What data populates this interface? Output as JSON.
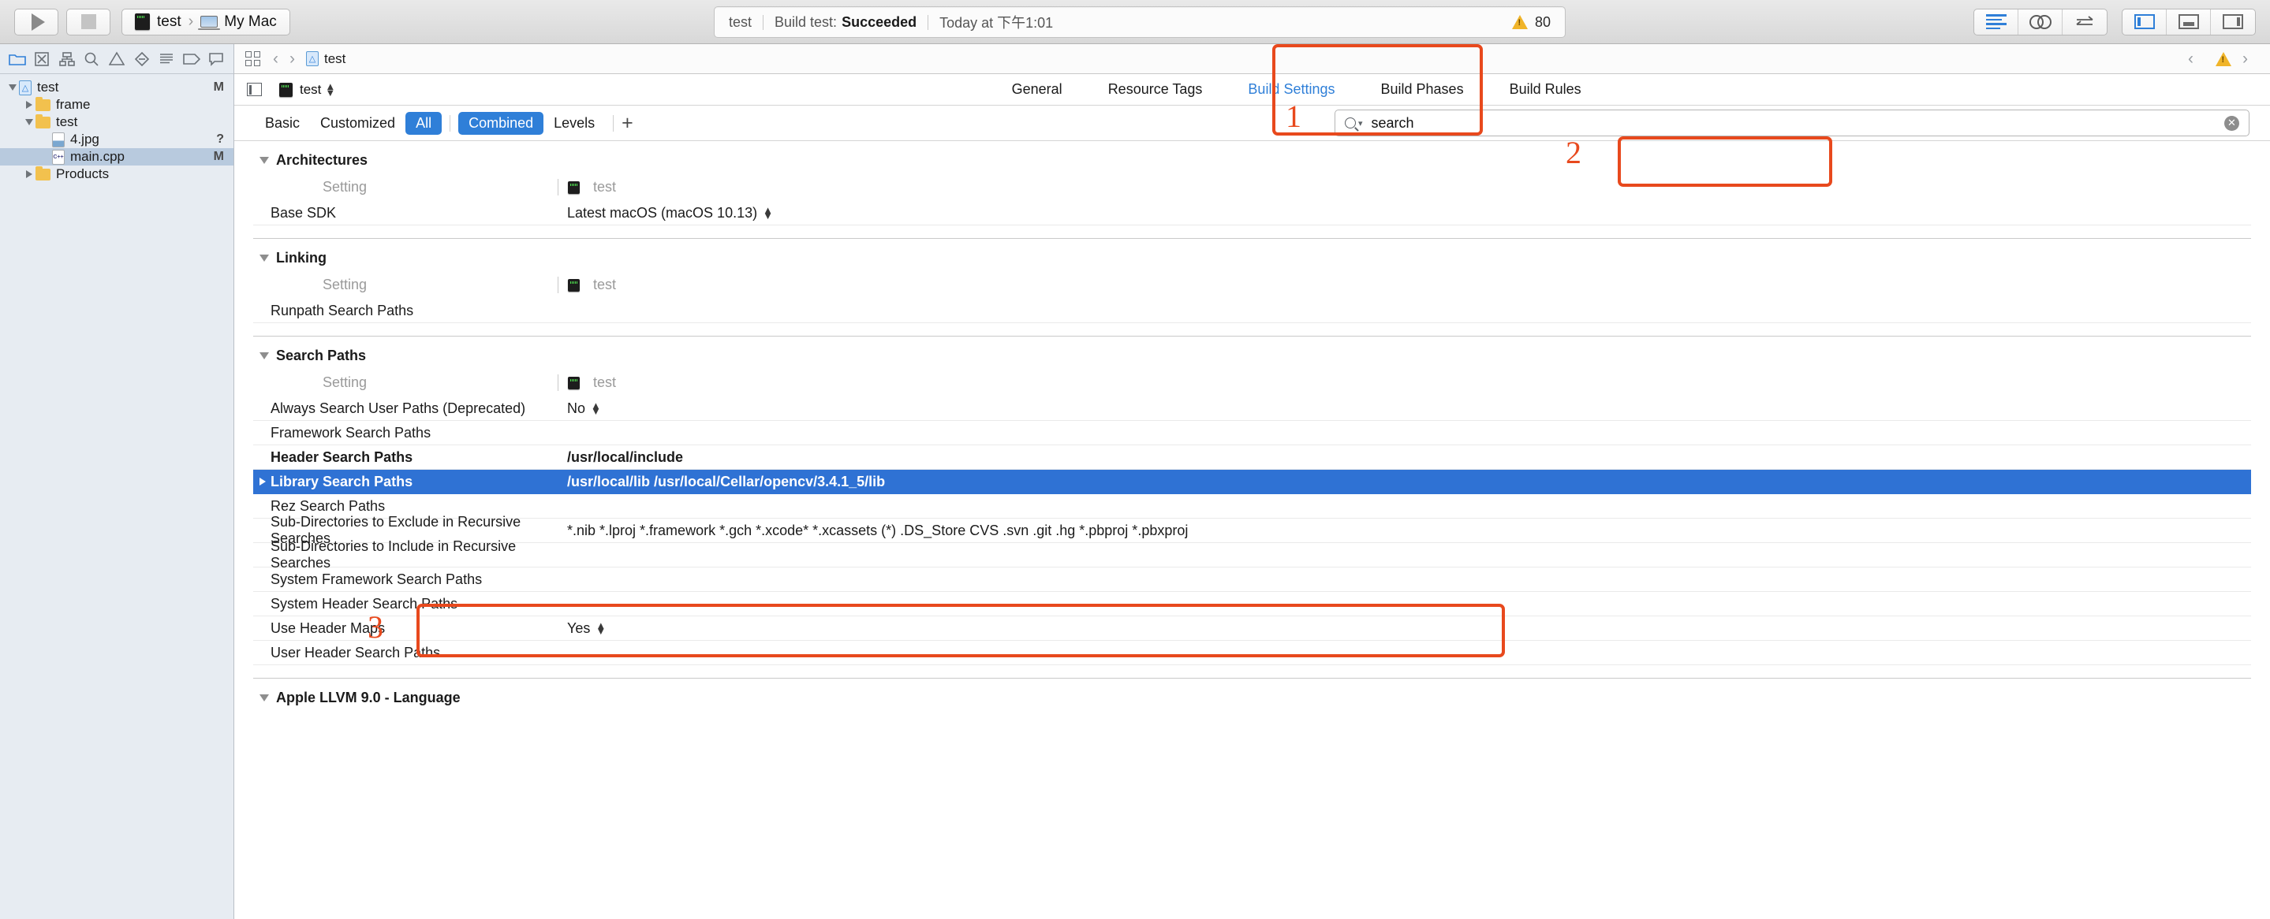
{
  "toolbar": {
    "run_label": "Run",
    "stop_label": "Stop",
    "scheme_name": "test",
    "destination": "My Mac",
    "status": {
      "project": "test",
      "action": "Build test:",
      "result": "Succeeded",
      "time": "Today at 下午1:01",
      "warning_count": "80"
    },
    "editor_modes": [
      "standard-editor",
      "assistant-editor",
      "version-editor"
    ],
    "panel_toggles": [
      "navigator-panel",
      "debug-panel",
      "utilities-panel"
    ]
  },
  "navigator": {
    "tabs": [
      "project-navigator-icon",
      "source-control-navigator-icon",
      "symbol-navigator-icon",
      "find-navigator-icon",
      "issue-navigator-icon",
      "test-navigator-icon",
      "debug-navigator-icon",
      "breakpoint-navigator-icon",
      "report-navigator-icon"
    ],
    "tree": [
      {
        "label": "test",
        "icon": "project",
        "indent": 0,
        "twisty": "down",
        "badge": "M",
        "selected": false
      },
      {
        "label": "frame",
        "icon": "folder",
        "indent": 1,
        "twisty": "right",
        "badge": "",
        "selected": false
      },
      {
        "label": "test",
        "icon": "folder",
        "indent": 1,
        "twisty": "down",
        "badge": "",
        "selected": false
      },
      {
        "label": "4.jpg",
        "icon": "image",
        "indent": 2,
        "twisty": "none",
        "badge": "?",
        "selected": false
      },
      {
        "label": "main.cpp",
        "icon": "cpp",
        "indent": 2,
        "twisty": "none",
        "badge": "M",
        "selected": true
      },
      {
        "label": "Products",
        "icon": "folder",
        "indent": 1,
        "twisty": "right",
        "badge": "",
        "selected": false
      }
    ]
  },
  "jumpbar": {
    "title": "test",
    "grid_icon": "related-items-icon",
    "back": "‹",
    "forward": "›"
  },
  "targetbar": {
    "target": "test"
  },
  "tabs": [
    {
      "label": "General",
      "active": false
    },
    {
      "label": "Resource Tags",
      "active": false
    },
    {
      "label": "Build Settings",
      "active": true
    },
    {
      "label": "Build Phases",
      "active": false
    },
    {
      "label": "Build Rules",
      "active": false
    }
  ],
  "filters": [
    {
      "label": "Basic",
      "on": false
    },
    {
      "label": "Customized",
      "on": false
    },
    {
      "label": "All",
      "on": true
    },
    {
      "label": "Combined",
      "on": true
    },
    {
      "label": "Levels",
      "on": false
    }
  ],
  "add_button": "+",
  "search": {
    "value": "search",
    "placeholder": "search",
    "clear": "✕"
  },
  "columns": {
    "setting": "Setting",
    "target": "test"
  },
  "sections": [
    {
      "title": "Architectures",
      "rows": [
        {
          "name": "Base SDK",
          "value": "Latest macOS (macOS 10.13)",
          "stepper": true,
          "bold": false,
          "selected": false,
          "twisty": false
        }
      ]
    },
    {
      "title": "Linking",
      "rows": [
        {
          "name": "Runpath Search Paths",
          "value": "",
          "stepper": false,
          "bold": false,
          "selected": false,
          "twisty": false
        }
      ]
    },
    {
      "title": "Search Paths",
      "rows": [
        {
          "name": "Always Search User Paths (Deprecated)",
          "value": "No",
          "stepper": true,
          "bold": false,
          "selected": false,
          "twisty": false
        },
        {
          "name": "Framework Search Paths",
          "value": "",
          "stepper": false,
          "bold": false,
          "selected": false,
          "twisty": false
        },
        {
          "name": "Header Search Paths",
          "value": "/usr/local/include",
          "stepper": false,
          "bold": true,
          "selected": false,
          "twisty": false
        },
        {
          "name": "Library Search Paths",
          "value": "/usr/local/lib /usr/local/Cellar/opencv/3.4.1_5/lib",
          "stepper": false,
          "bold": true,
          "selected": true,
          "twisty": true
        },
        {
          "name": "Rez Search Paths",
          "value": "",
          "stepper": false,
          "bold": false,
          "selected": false,
          "twisty": false
        },
        {
          "name": "Sub-Directories to Exclude in Recursive Searches",
          "value": "*.nib *.lproj *.framework *.gch *.xcode* *.xcassets (*) .DS_Store CVS .svn .git .hg *.pbproj *.pbxproj",
          "stepper": false,
          "bold": false,
          "selected": false,
          "twisty": false
        },
        {
          "name": "Sub-Directories to Include in Recursive Searches",
          "value": "",
          "stepper": false,
          "bold": false,
          "selected": false,
          "twisty": false
        },
        {
          "name": "System Framework Search Paths",
          "value": "",
          "stepper": false,
          "bold": false,
          "selected": false,
          "twisty": false
        },
        {
          "name": "System Header Search Paths",
          "value": "",
          "stepper": false,
          "bold": false,
          "selected": false,
          "twisty": false
        },
        {
          "name": "Use Header Maps",
          "value": "Yes",
          "stepper": true,
          "bold": false,
          "selected": false,
          "twisty": false
        },
        {
          "name": "User Header Search Paths",
          "value": "",
          "stepper": false,
          "bold": false,
          "selected": false,
          "twisty": false
        }
      ]
    },
    {
      "title": "Apple LLVM 9.0 - Language",
      "rows": []
    }
  ],
  "annotations": [
    {
      "number": "1",
      "target": "build-settings-tab"
    },
    {
      "number": "2",
      "target": "search-field"
    },
    {
      "number": "3",
      "target": "search-paths-rows"
    }
  ]
}
